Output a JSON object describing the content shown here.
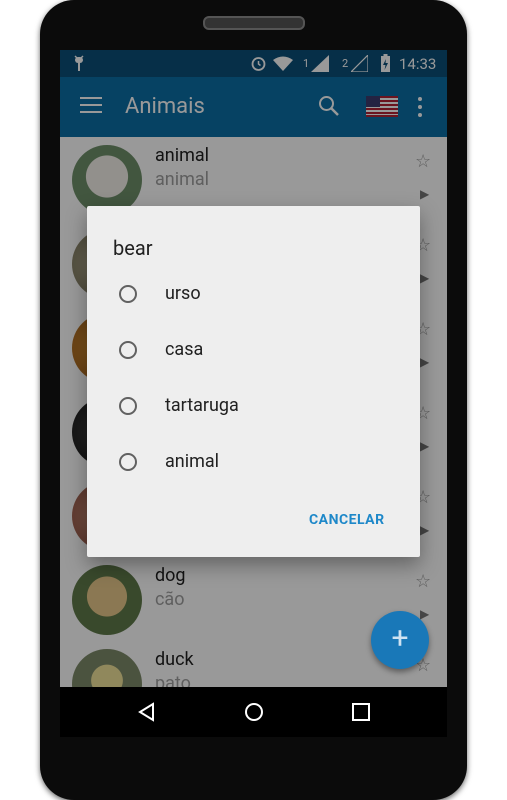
{
  "status_bar": {
    "sim1": "1",
    "sim2": "2",
    "time": "14:33",
    "icons": [
      "android-debug-icon",
      "alarm-icon",
      "wifi-icon",
      "signal-icon",
      "signal-icon",
      "battery-charging-icon"
    ]
  },
  "app_bar": {
    "title": "Animais",
    "icons": [
      "menu-icon",
      "search-icon",
      "us-flag-icon",
      "more-vert-icon"
    ]
  },
  "list": {
    "items": [
      {
        "en": "animal",
        "pt": "animal"
      },
      {
        "en": "",
        "pt": ""
      },
      {
        "en": "",
        "pt": ""
      },
      {
        "en": "",
        "pt": ""
      },
      {
        "en": "",
        "pt": ""
      },
      {
        "en": "dog",
        "pt": "cão"
      },
      {
        "en": "duck",
        "pt": "pato"
      }
    ]
  },
  "dialog": {
    "title": "bear",
    "options": [
      "urso",
      "casa",
      "tartaruga",
      "animal"
    ],
    "cancel_label": "CANCELAR"
  },
  "fab": {
    "label": "+"
  },
  "colors": {
    "status_bar": "#0b4f79",
    "app_bar": "#0b6ea6",
    "accent": "#1e88c9",
    "fab": "#1978b8"
  }
}
